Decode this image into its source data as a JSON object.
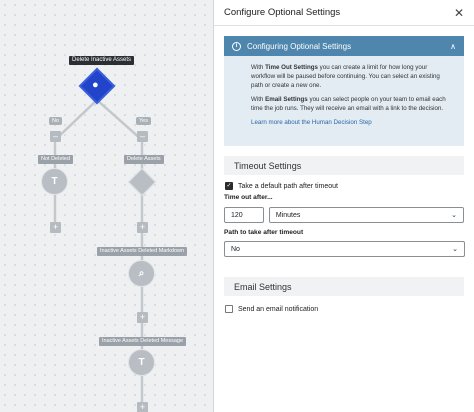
{
  "canvas": {
    "nodes": {
      "root_label": "Delete Inactive Assets",
      "branch_no": "No",
      "branch_yes": "Yes",
      "not_deleted": "Not Deleted",
      "delete_assets": "Delete Assets",
      "inactive_markdown": "Inactive Assets Deleted Markdown",
      "inactive_message": "Inactive Assets Deleted Message"
    },
    "plus_glyph": "+",
    "dash_glyph": "–"
  },
  "panel": {
    "title": "Configure Optional Settings",
    "close_glyph": "✕",
    "info": {
      "heading": "Configuring Optional Settings",
      "icon_glyph": "i",
      "chevron_glyph": "∧",
      "p1_strong": "Time Out Settings",
      "p1_pre": "With ",
      "p1_rest": " you can create a limit for how long your workflow will be paused before continuing. You can select an existing path or create a new one.",
      "p2_pre": "With ",
      "p2_strong": "Email Settings",
      "p2_rest": " you can select people on your team to email each time the job runs. They will receive an email with a link to the decision.",
      "link": "Learn more about the Human Decision Step"
    },
    "timeout": {
      "section_title": "Timeout Settings",
      "default_path_label": "Take a default path after timeout",
      "default_path_checked": true,
      "time_out_after_label": "Time out after...",
      "amount_value": "120",
      "unit_value": "Minutes",
      "path_label": "Path to take after timeout",
      "path_value": "No"
    },
    "email": {
      "section_title": "Email Settings",
      "notify_label": "Send an email notification",
      "notify_checked": false
    },
    "check_glyph": "✓",
    "select_arrow_glyph": "⌄"
  }
}
